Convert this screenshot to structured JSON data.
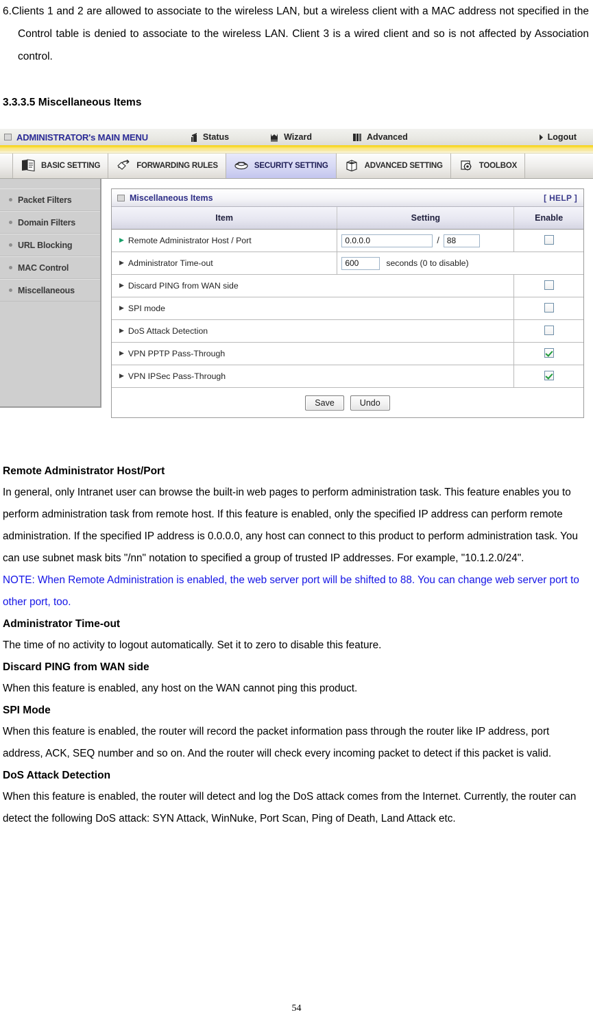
{
  "document": {
    "list_item_number": "6.",
    "list_item_text": "Clients 1 and 2 are allowed to associate to the wireless LAN, but a wireless client with a MAC address not specified in the Control table is denied to associate to the wireless LAN. Client 3 is a wired client and so is not affected by Association control.",
    "section_heading": "3.3.3.5 Miscellaneous Items",
    "page_number": "54",
    "sections": [
      {
        "heading": "Remote Administrator Host/Port",
        "paragraphs": [
          {
            "text": "In general, only Intranet user can browse the built-in web pages to perform administration task. This feature enables you to perform administration task from remote host. If this feature is enabled, only the specified IP address can perform remote administration. If the specified IP address is 0.0.0.0, any host can connect to this product to perform administration task. You can use subnet mask bits \"/nn\" notation to specified a group of trusted IP addresses. For example, \"10.1.2.0/24\".",
            "style": "normal"
          },
          {
            "text": "NOTE: When Remote Administration is enabled, the web server port will be shifted to 88. You can change web server port to other port, too.",
            "style": "note"
          }
        ]
      },
      {
        "heading": "Administrator Time-out",
        "paragraphs": [
          {
            "text": "The time of no activity to logout automatically. Set it to zero to disable this feature.",
            "style": "normal"
          }
        ]
      },
      {
        "heading": "Discard PING from WAN side",
        "paragraphs": [
          {
            "text": "When this feature is enabled, any host on the WAN cannot ping this product.",
            "style": "normal"
          }
        ]
      },
      {
        "heading": "SPI Mode",
        "paragraphs": [
          {
            "text": "When this feature is enabled, the router will record the packet information pass through the router like IP address, port address, ACK, SEQ number and so on. And the router will check every incoming packet to detect if this packet is valid.",
            "style": "normal"
          }
        ]
      },
      {
        "heading": "DoS Attack Detection",
        "paragraphs": [
          {
            "text": "When this feature is enabled, the router will detect and log the DoS attack comes from the Internet. Currently, the router can detect the following DoS attack: SYN Attack, WinNuke, Port Scan, Ping of Death, Land Attack etc.",
            "style": "normal"
          }
        ]
      }
    ]
  },
  "router_ui": {
    "topbar": {
      "brand": "ADMINISTRATOR's MAIN MENU",
      "links": [
        {
          "label": "Status",
          "icon": "status-icon"
        },
        {
          "label": "Wizard",
          "icon": "wizard-icon"
        },
        {
          "label": "Advanced",
          "icon": "advanced-icon"
        }
      ],
      "logout_label": "Logout"
    },
    "tabs": [
      {
        "label": "BASIC SETTING",
        "icon": "book-icon",
        "active": false
      },
      {
        "label": "FORWARDING RULES",
        "icon": "arrows-icon",
        "active": false
      },
      {
        "label": "SECURITY SETTING",
        "icon": "shield-icon",
        "active": true
      },
      {
        "label": "ADVANCED SETTING",
        "icon": "cube-icon",
        "active": false
      },
      {
        "label": "TOOLBOX",
        "icon": "gear-icon",
        "active": false
      }
    ],
    "sidebar": {
      "items": [
        {
          "label": "Packet Filters"
        },
        {
          "label": "Domain Filters"
        },
        {
          "label": "URL Blocking"
        },
        {
          "label": "MAC Control"
        },
        {
          "label": "Miscellaneous"
        }
      ]
    },
    "panel": {
      "title": "Miscellaneous Items",
      "help_label": "[ HELP ]",
      "columns": [
        "Item",
        "Setting",
        "Enable"
      ],
      "rows": [
        {
          "item": "Remote Administrator Host / Port",
          "arrow_color": "green",
          "setting_type": "host_port",
          "host_value": "0.0.0.0",
          "separator": "/",
          "port_value": "88",
          "enable": false,
          "has_enable": true
        },
        {
          "item": "Administrator Time-out",
          "arrow_color": "dark",
          "setting_type": "timeout",
          "timeout_value": "600",
          "unit_label": "seconds (0 to disable)",
          "has_enable": false
        },
        {
          "item": "Discard PING from WAN side",
          "arrow_color": "dark",
          "setting_type": "none",
          "enable": false,
          "has_enable": true
        },
        {
          "item": "SPI mode",
          "arrow_color": "dark",
          "setting_type": "none",
          "enable": false,
          "has_enable": true
        },
        {
          "item": "DoS Attack Detection",
          "arrow_color": "dark",
          "setting_type": "none",
          "enable": false,
          "has_enable": true
        },
        {
          "item": "VPN PPTP Pass-Through",
          "arrow_color": "dark",
          "setting_type": "none",
          "enable": true,
          "has_enable": true
        },
        {
          "item": "VPN IPSec Pass-Through",
          "arrow_color": "dark",
          "setting_type": "none",
          "enable": true,
          "has_enable": true
        }
      ],
      "save_label": "Save",
      "undo_label": "Undo"
    },
    "colors": {
      "brand_text": "#2b2b96",
      "accent_yellow": "#f7d100",
      "active_tab": "#d6d8f4",
      "checkbox_check": "#1e9b3a",
      "note_text": "#1414e6"
    }
  }
}
